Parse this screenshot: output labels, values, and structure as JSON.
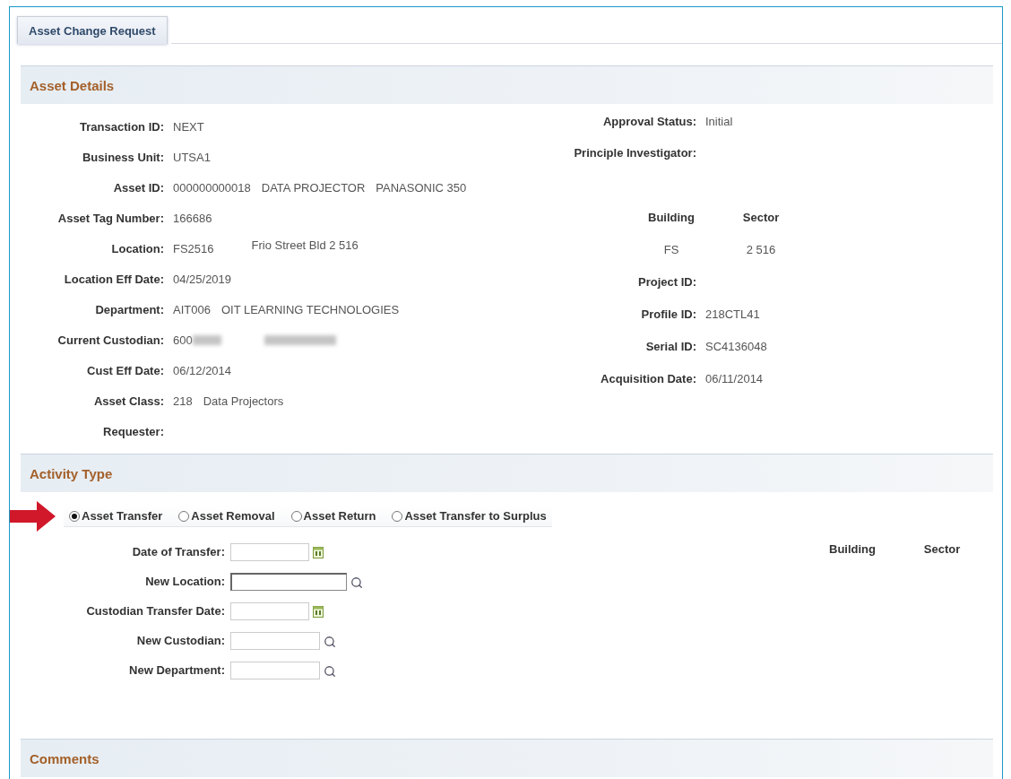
{
  "tabs": [
    {
      "label": "Asset Change Request",
      "selected": true
    }
  ],
  "asset_details": {
    "title": "Asset Details",
    "left_fields": [
      {
        "label": "Transaction ID:",
        "values": [
          "NEXT"
        ]
      },
      {
        "label": "Business Unit:",
        "values": [
          "UTSA1"
        ]
      },
      {
        "label": "Asset ID:",
        "values": [
          "000000000018",
          "DATA PROJECTOR",
          "PANASONIC 350"
        ]
      },
      {
        "label": "Asset Tag Number:",
        "values": [
          "166686"
        ]
      },
      {
        "label": "Location:",
        "values": [
          "FS2516",
          "Frio Street Bld 2 516"
        ]
      },
      {
        "label": "Location Eff Date:",
        "values": [
          "04/25/2019"
        ]
      },
      {
        "label": "Department:",
        "values": [
          "AIT006",
          "OIT LEARNING TECHNOLOGIES"
        ]
      },
      {
        "label": "Current Custodian:",
        "values": [
          "600"
        ],
        "redacted": true
      },
      {
        "label": "Cust Eff Date:",
        "values": [
          "06/12/2014"
        ]
      },
      {
        "label": "Asset Class:",
        "values": [
          "218",
          "Data Projectors"
        ]
      },
      {
        "label": "Requester:"
      }
    ],
    "right_fields": [
      {
        "kind": "field",
        "label": "Approval Status:",
        "values": [
          "Initial"
        ]
      },
      {
        "kind": "field",
        "label": "Principle Investigator:"
      },
      {
        "kind": "location_table",
        "headers": [
          "Building",
          "Sector"
        ],
        "values": [
          "FS",
          "2 516"
        ]
      },
      {
        "kind": "field",
        "label": "Project ID:"
      },
      {
        "kind": "field",
        "label": "Profile ID:",
        "values": [
          "218CTL41"
        ]
      },
      {
        "kind": "field",
        "label": "Serial ID:",
        "values": [
          "SC4136048"
        ]
      },
      {
        "kind": "field",
        "label": "Acquisition Date:",
        "values": [
          "06/11/2014"
        ]
      }
    ]
  },
  "activity_type": {
    "title": "Activity Type",
    "pointer_arrow": true,
    "options": [
      {
        "label": "Asset Transfer",
        "selected": true
      },
      {
        "label": "Asset Removal",
        "selected": false
      },
      {
        "label": "Asset Return",
        "selected": false
      },
      {
        "label": "Asset Transfer to Surplus",
        "selected": false
      }
    ],
    "fields": [
      {
        "label": "Date of Transfer:",
        "kind": "date",
        "focused": false
      },
      {
        "label": "New Location:",
        "kind": "lookup",
        "focused": true
      },
      {
        "label": "Custodian Transfer Date:",
        "kind": "date",
        "focused": false
      },
      {
        "label": "New Custodian:",
        "kind": "lookup",
        "focused": false
      },
      {
        "label": "New Department:",
        "kind": "lookup",
        "focused": false
      }
    ],
    "location_headers": [
      "Building",
      "Sector"
    ]
  },
  "comments": {
    "title": "Comments"
  }
}
